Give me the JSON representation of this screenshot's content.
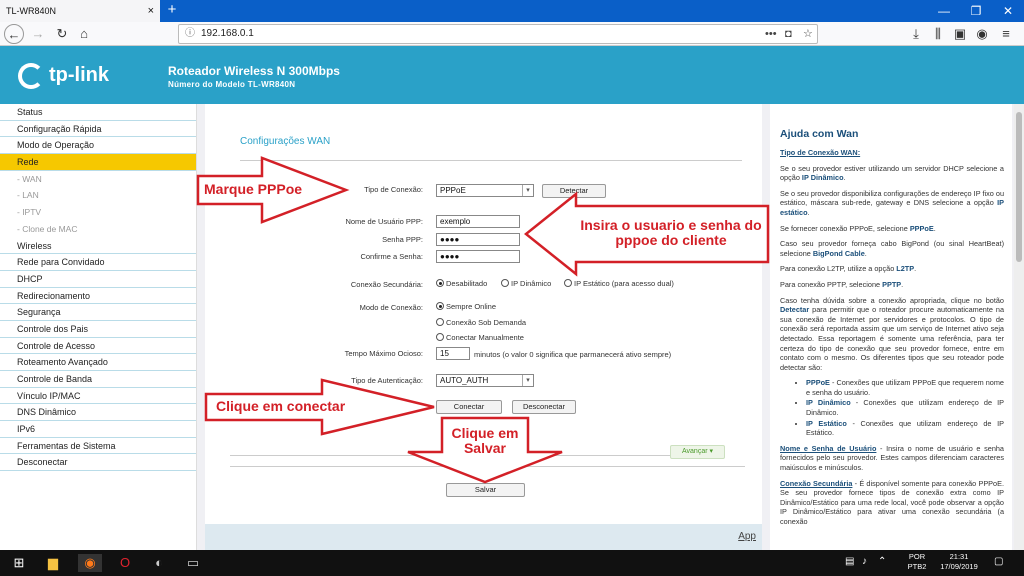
{
  "browser": {
    "tab_title": "TL-WR840N",
    "url": "192.168.0.1",
    "close_glyph": "×",
    "newtab_glyph": "+"
  },
  "banner": {
    "logo": "tp-link",
    "title": "Roteador Wireless N 300Mbps",
    "subtitle": "Número do Modelo TL-WR840N"
  },
  "sidebar": {
    "items": [
      {
        "label": "Status",
        "type": "item"
      },
      {
        "label": "Configuração Rápida",
        "type": "item"
      },
      {
        "label": "Modo de Operação",
        "type": "item"
      },
      {
        "label": "Rede",
        "type": "active"
      },
      {
        "label": "- WAN",
        "type": "sub"
      },
      {
        "label": "- LAN",
        "type": "sub"
      },
      {
        "label": "- IPTV",
        "type": "sub"
      },
      {
        "label": "- Clone de MAC",
        "type": "sub"
      },
      {
        "label": "Wireless",
        "type": "item"
      },
      {
        "label": "Rede para Convidado",
        "type": "item"
      },
      {
        "label": "DHCP",
        "type": "item"
      },
      {
        "label": "Redirecionamento",
        "type": "item"
      },
      {
        "label": "Segurança",
        "type": "item"
      },
      {
        "label": "Controle dos Pais",
        "type": "item"
      },
      {
        "label": "Controle de Acesso",
        "type": "item"
      },
      {
        "label": "Roteamento Avançado",
        "type": "item"
      },
      {
        "label": "Controle de Banda",
        "type": "item"
      },
      {
        "label": "Vínculo IP/MAC",
        "type": "item"
      },
      {
        "label": "DNS Dinâmico",
        "type": "item"
      },
      {
        "label": "IPv6",
        "type": "item"
      },
      {
        "label": "Ferramentas de Sistema",
        "type": "item"
      },
      {
        "label": "Desconectar",
        "type": "item"
      }
    ]
  },
  "form": {
    "section_title": "Configurações WAN",
    "conn_type_label": "Tipo de Conexão:",
    "conn_type_value": "PPPoE",
    "detect_button": "Detectar",
    "user_label": "Nome de Usuário PPP:",
    "user_value": "exemplo",
    "pass_label": "Senha PPP:",
    "pass_value": "●●●●",
    "confirm_label": "Confirme a Senha:",
    "confirm_value": "●●●●",
    "secondary_label": "Conexão Secundária:",
    "secondary_options": [
      "Desabilitado",
      "IP Dinâmico",
      "IP Estático (para acesso dual)"
    ],
    "mode_label": "Modo de Conexão:",
    "mode_options": [
      "Sempre Online",
      "Conexão Sob Demanda",
      "Conectar Manualmente"
    ],
    "idle_label": "Tempo Máximo Ocioso:",
    "idle_value": "15",
    "idle_note": "minutos (o valor 0 significa que parmanecerá ativo sempre)",
    "auth_label": "Tipo de Autenticação:",
    "auth_value": "AUTO_AUTH",
    "connect_button": "Conectar",
    "disconnect_button": "Desconectar",
    "advanced_button": "Avançar",
    "save_button": "Salvar",
    "footer_link": "App"
  },
  "annotations": {
    "pppoe": "Marque PPPoe",
    "user": "Insira o usuario e senha do pppoe do cliente",
    "connect": "Clique em conectar",
    "save": "Clique em Salvar",
    "color": "#d32027"
  },
  "help": {
    "title": "Ajuda com Wan",
    "conn_type_title": "Tipo de Conexão WAN:",
    "p1_pre": "Se o seu provedor estiver utilizando um servidor DHCP selecione a opção ",
    "p1_link": "IP Dinâmico",
    "p1_post": ".",
    "p2_pre": "Se o seu provedor disponibiliza configurações de endereço IP fixo ou estático, máscara sub-rede, gateway e DNS selecione a opção ",
    "p2_link": "IP estático",
    "p2_post": ".",
    "p3_pre": "Se fornecer conexão PPPoE, selecione ",
    "p3_link": "PPPoE",
    "p3_post": ".",
    "p4_pre": "Caso seu provedor forneça cabo BigPond (ou sinal HeartBeat) selecione ",
    "p4_link": "BigPond Cable",
    "p4_post": ".",
    "p5_pre": "Para conexão L2TP, utilize a opção ",
    "p5_link": "L2TP",
    "p5_post": ".",
    "p6_pre": "Para conexão PPTP, selecione ",
    "p6_link": "PPTP",
    "p6_post": ".",
    "p7_pre": "Caso tenha dúvida sobre a conexão apropriada, clique no botão ",
    "p7_link": "Detectar",
    "p7_post": " para permitir que o roteador procure automaticamente na sua conexão de Internet por servidores e protocolos. O tipo de conexão será reportada assim que um serviço de Internet ativo seja detectado. Essa reportagem é somente uma referência, para ter certeza do tipo de conexão que seu provedor fornece, entre em contato com o mesmo. Os diferentes tipos que seu roteador pode detectar são:",
    "bullets": [
      {
        "key": "PPPoE",
        "text": " - Conexões que utilizam PPPoE que requerem nome e senha do usuário."
      },
      {
        "key": "IP Dinâmico",
        "text": " - Conexões que utilizam endereço de IP Dinâmico."
      },
      {
        "key": "IP Estático",
        "text": " - Conexões que utilizam endereço de IP Estático."
      }
    ],
    "p8_title": "Nome e Senha de Usuário",
    "p8_text": " - Insira o nome de usuário e senha fornecidos pelo seu provedor. Estes campos diferenciam caracteres maiúsculos e minúsculos.",
    "p9_title": "Conexão Secundária",
    "p9_text": " - É disponível somente para conexão PPPoE. Se seu provedor fornece tipos de conexão extra como IP Dinâmico/Estático para uma rede local, você pode observar a opção IP Dinâmico/Estático para ativar uma conexão secundária (a conexão"
  },
  "taskbar": {
    "lang1": "POR",
    "lang2": "PTB2",
    "time": "21:31",
    "date": "17/09/2019"
  }
}
